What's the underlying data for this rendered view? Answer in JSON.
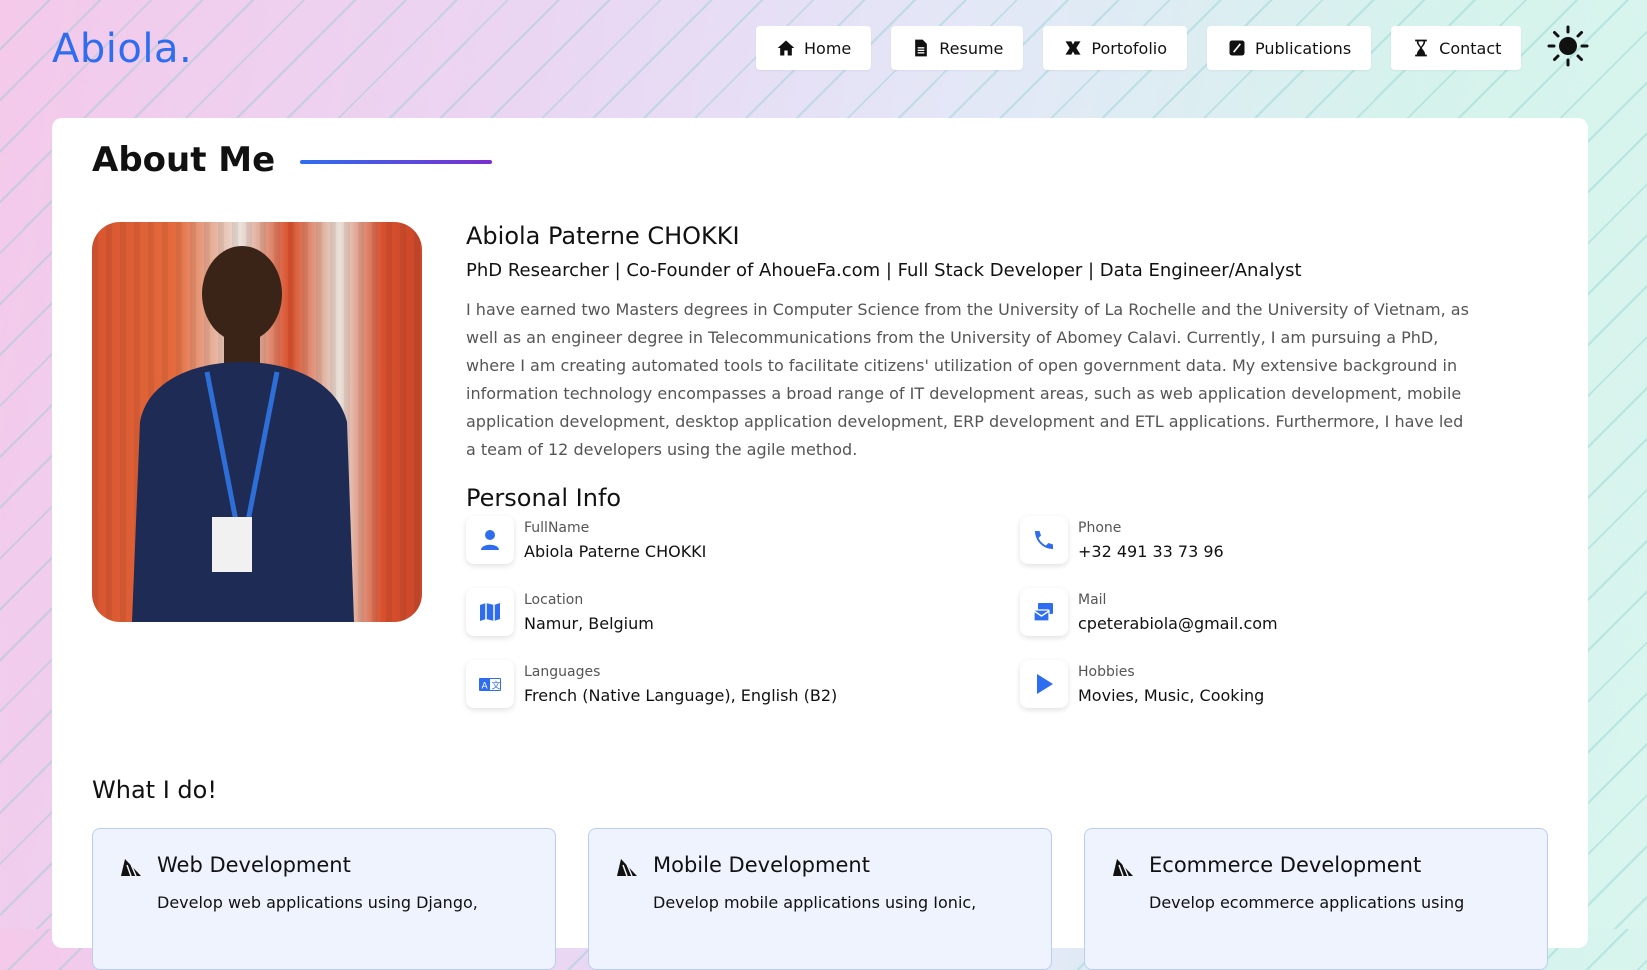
{
  "header": {
    "logo": "Abiola.",
    "nav": [
      {
        "label": "Home",
        "icon": "home-icon"
      },
      {
        "label": "Resume",
        "icon": "document-icon"
      },
      {
        "label": "Portofolio",
        "icon": "puzzle-icon"
      },
      {
        "label": "Publications",
        "icon": "pen-icon"
      },
      {
        "label": "Contact",
        "icon": "hourglass-icon"
      }
    ],
    "theme_toggle_icon": "sun-icon"
  },
  "about": {
    "title": "About Me",
    "name": "Abiola Paterne CHOKKI",
    "role": "PhD Researcher | Co-Founder of AhoueFa.com | Full Stack Developer | Data Engineer/Analyst",
    "bio": "I have earned two Masters degrees in Computer Science from the University of La Rochelle and the University of Vietnam, as well as an engineer degree in Telecommunications from the University of Abomey Calavi. Currently, I am pursuing a PhD, where I am creating automated tools to facilitate citizens' utilization of open government data. My extensive background in information technology encompasses a broad range of IT development areas, such as web application development, mobile application development, desktop application development, ERP development and ETL applications. Furthermore, I have led a team of 12 developers using the agile method."
  },
  "personal_info": {
    "title": "Personal Info",
    "items": [
      {
        "label": "FullName",
        "value": "Abiola Paterne CHOKKI",
        "icon": "user-icon"
      },
      {
        "label": "Phone",
        "value": "+32 491 33 73 96",
        "icon": "phone-icon"
      },
      {
        "label": "Location",
        "value": "Namur, Belgium",
        "icon": "map-icon"
      },
      {
        "label": "Mail",
        "value": "cpeterabiola@gmail.com",
        "icon": "mail-icon"
      },
      {
        "label": "Languages",
        "value": "French (Native Language), English (B2)",
        "icon": "translate-icon"
      },
      {
        "label": "Hobbies",
        "value": "Movies, Music, Cooking",
        "icon": "play-icon"
      }
    ]
  },
  "what_i_do": {
    "title": "What I do!",
    "services": [
      {
        "title": "Web Development",
        "desc": "Develop web applications using Django,"
      },
      {
        "title": "Mobile Development",
        "desc": "Develop mobile applications using Ionic,"
      },
      {
        "title": "Ecommerce Development",
        "desc": "Develop ecommerce applications using"
      }
    ]
  },
  "colors": {
    "accent": "#2f6df0",
    "accent2": "#7b2fd0"
  }
}
